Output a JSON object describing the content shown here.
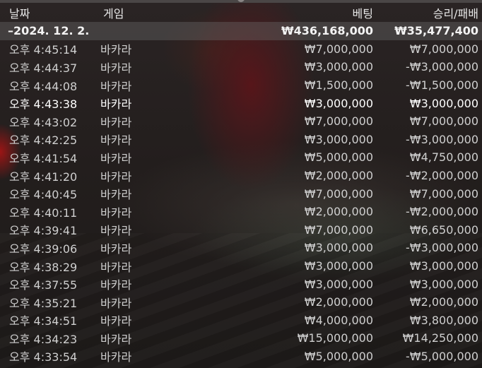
{
  "header": {
    "date": "날짜",
    "game": "게임",
    "bet": "베팅",
    "result": "승리/패배"
  },
  "summary": {
    "date": "–2024. 12. 2.",
    "bet": "₩436,168,000",
    "result": "₩35,477,400"
  },
  "rows": [
    {
      "time": "오후 4:45:14",
      "game": "바카라",
      "bet": "₩7,000,000",
      "result": "₩7,000,000"
    },
    {
      "time": "오후 4:44:37",
      "game": "바카라",
      "bet": "₩3,000,000",
      "result": "-₩3,000,000"
    },
    {
      "time": "오후 4:44:08",
      "game": "바카라",
      "bet": "₩1,500,000",
      "result": "-₩1,500,000"
    },
    {
      "time": "오후 4:43:38",
      "game": "바카라",
      "bet": "₩3,000,000",
      "result": "₩3,000,000"
    },
    {
      "time": "오후 4:43:02",
      "game": "바카라",
      "bet": "₩7,000,000",
      "result": "₩7,000,000"
    },
    {
      "time": "오후 4:42:25",
      "game": "바카라",
      "bet": "₩3,000,000",
      "result": "-₩3,000,000"
    },
    {
      "time": "오후 4:41:54",
      "game": "바카라",
      "bet": "₩5,000,000",
      "result": "₩4,750,000"
    },
    {
      "time": "오후 4:41:20",
      "game": "바카라",
      "bet": "₩2,000,000",
      "result": "-₩2,000,000"
    },
    {
      "time": "오후 4:40:45",
      "game": "바카라",
      "bet": "₩7,000,000",
      "result": "₩7,000,000"
    },
    {
      "time": "오후 4:40:11",
      "game": "바카라",
      "bet": "₩2,000,000",
      "result": "-₩2,000,000"
    },
    {
      "time": "오후 4:39:41",
      "game": "바카라",
      "bet": "₩7,000,000",
      "result": "₩6,650,000"
    },
    {
      "time": "오후 4:39:06",
      "game": "바카라",
      "bet": "₩3,000,000",
      "result": "-₩3,000,000"
    },
    {
      "time": "오후 4:38:29",
      "game": "바카라",
      "bet": "₩3,000,000",
      "result": "₩3,000,000"
    },
    {
      "time": "오후 4:37:55",
      "game": "바카라",
      "bet": "₩3,000,000",
      "result": "₩3,000,000"
    },
    {
      "time": "오후 4:35:21",
      "game": "바카라",
      "bet": "₩2,000,000",
      "result": "₩2,000,000"
    },
    {
      "time": "오후 4:34:51",
      "game": "바카라",
      "bet": "₩4,000,000",
      "result": "₩3,800,000"
    },
    {
      "time": "오후 4:34:23",
      "game": "바카라",
      "bet": "₩15,000,000",
      "result": "₩14,250,000"
    },
    {
      "time": "오후 4:33:54",
      "game": "바카라",
      "bet": "₩5,000,000",
      "result": "-₩5,000,000"
    }
  ]
}
